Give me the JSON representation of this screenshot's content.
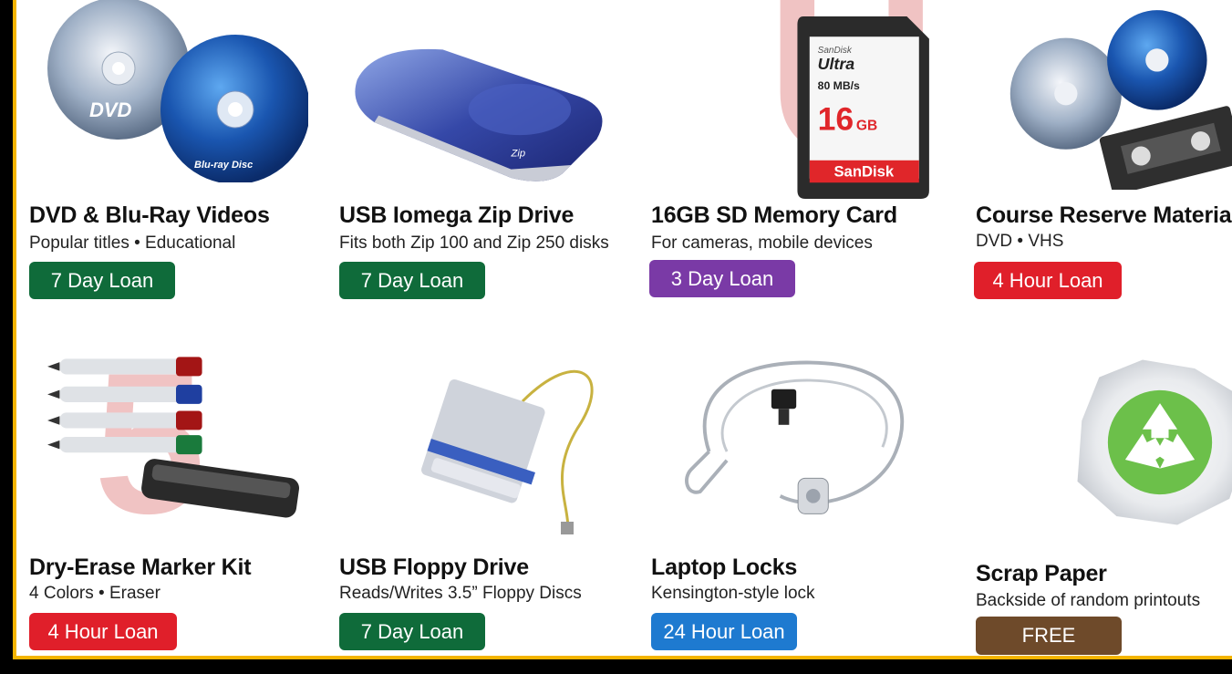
{
  "colors": {
    "green": "#0f6b3a",
    "purple": "#7a3aa6",
    "red": "#e01f2a",
    "blue": "#1e7ad0",
    "brown": "#6e4a2a",
    "border": "#f4b400"
  },
  "items": [
    {
      "title": "DVD & Blu-Ray Videos",
      "subtitle": "Popular titles • Educational",
      "loan": "7 Day Loan",
      "icon": "dvd-bluray-disc-icon"
    },
    {
      "title": "USB Iomega Zip Drive",
      "subtitle": "Fits both Zip 100 and Zip 250 disks",
      "loan": "7 Day Loan",
      "icon": "zip-drive-icon"
    },
    {
      "title": "16GB SD Memory Card",
      "subtitle": "For cameras, mobile devices",
      "loan": "3 Day Loan",
      "icon": "sd-card-icon"
    },
    {
      "title": "Course Reserve Materials",
      "subtitle": "DVD • VHS",
      "loan": "4 Hour Loan",
      "icon": "course-reserve-media-icon"
    },
    {
      "title": "Dry-Erase Marker Kit",
      "subtitle": "4 Colors • Eraser",
      "loan": "4 Hour Loan",
      "icon": "marker-kit-icon"
    },
    {
      "title": "USB Floppy Drive",
      "subtitle": "Reads/Writes 3.5” Floppy Discs",
      "loan": "7 Day Loan",
      "icon": "floppy-drive-icon"
    },
    {
      "title": "Laptop Locks",
      "subtitle": "Kensington-style lock",
      "loan": "24 Hour Loan",
      "icon": "laptop-lock-icon"
    },
    {
      "title": "Scrap Paper",
      "subtitle": "Backside of random printouts",
      "loan": "FREE",
      "icon": "recycle-icon"
    }
  ],
  "media_labels": {
    "dvd": "DVD",
    "bluray": "Blu-ray Disc",
    "sd_brand_top": "SanDisk",
    "sd_model": "Ultra",
    "sd_speed": "80 MB/s",
    "sd_capacity": "16",
    "sd_unit": "GB",
    "sd_brand": "SanDisk",
    "zip_label": "Zip",
    "watermark_u": "U",
    "watermark_5": "5"
  }
}
